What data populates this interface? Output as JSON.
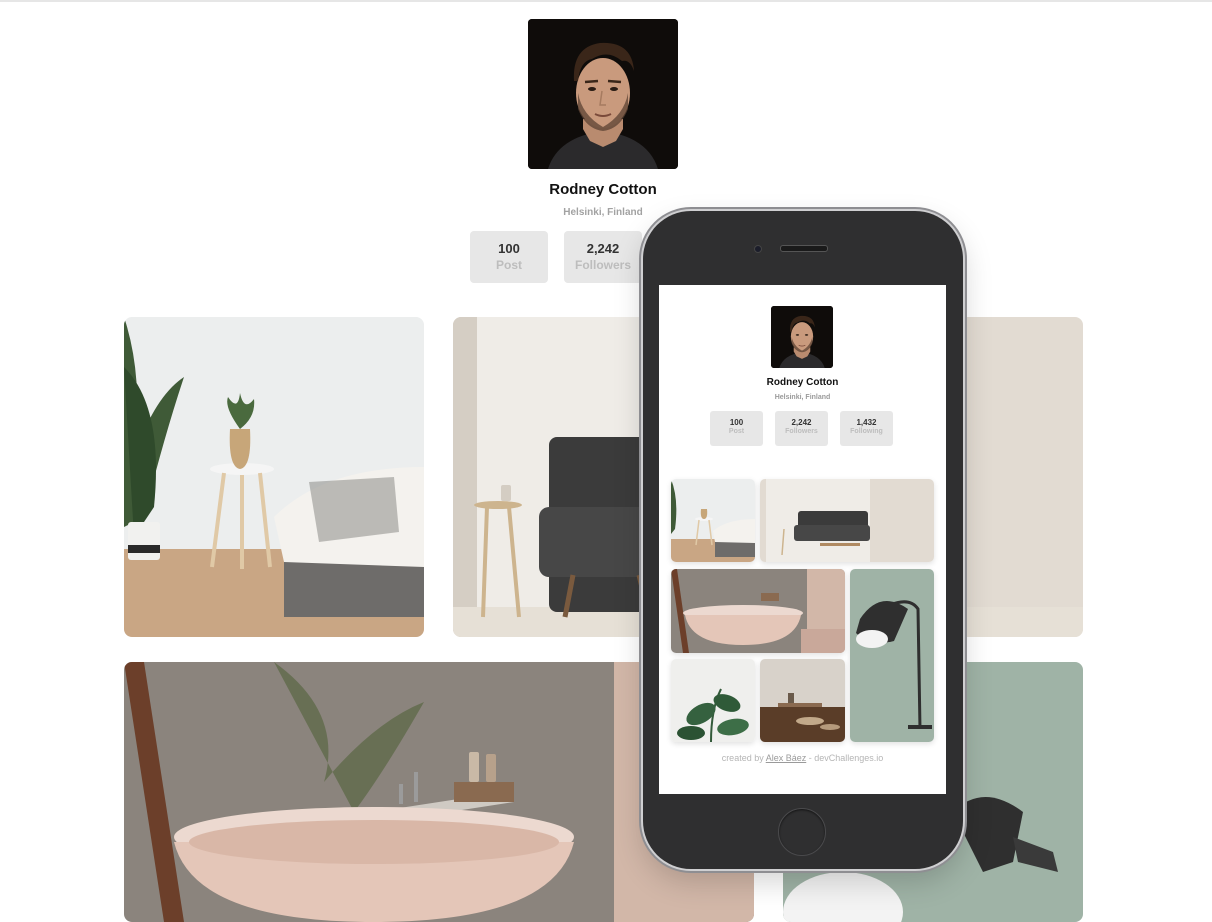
{
  "profile": {
    "name": "Rodney Cotton",
    "location": "Helsinki, Finland",
    "stats": [
      {
        "value": "100",
        "label": "Post"
      },
      {
        "value": "2,242",
        "label": "Followers"
      },
      {
        "value": "1,432",
        "label": "Following"
      }
    ]
  },
  "footer": {
    "prefix": "created by ",
    "author": "Alex Báez",
    "separator": " - ",
    "site": "devChallenges.io"
  },
  "colors": {
    "stat_bg": "#e7e7e7",
    "stat_label": "#bdbdbd",
    "phone_body": "#2f2f30",
    "text_dark": "#111111"
  },
  "icons": {
    "camera": "front-camera-icon",
    "speaker": "earpiece-speaker-icon",
    "home": "home-button-icon"
  }
}
